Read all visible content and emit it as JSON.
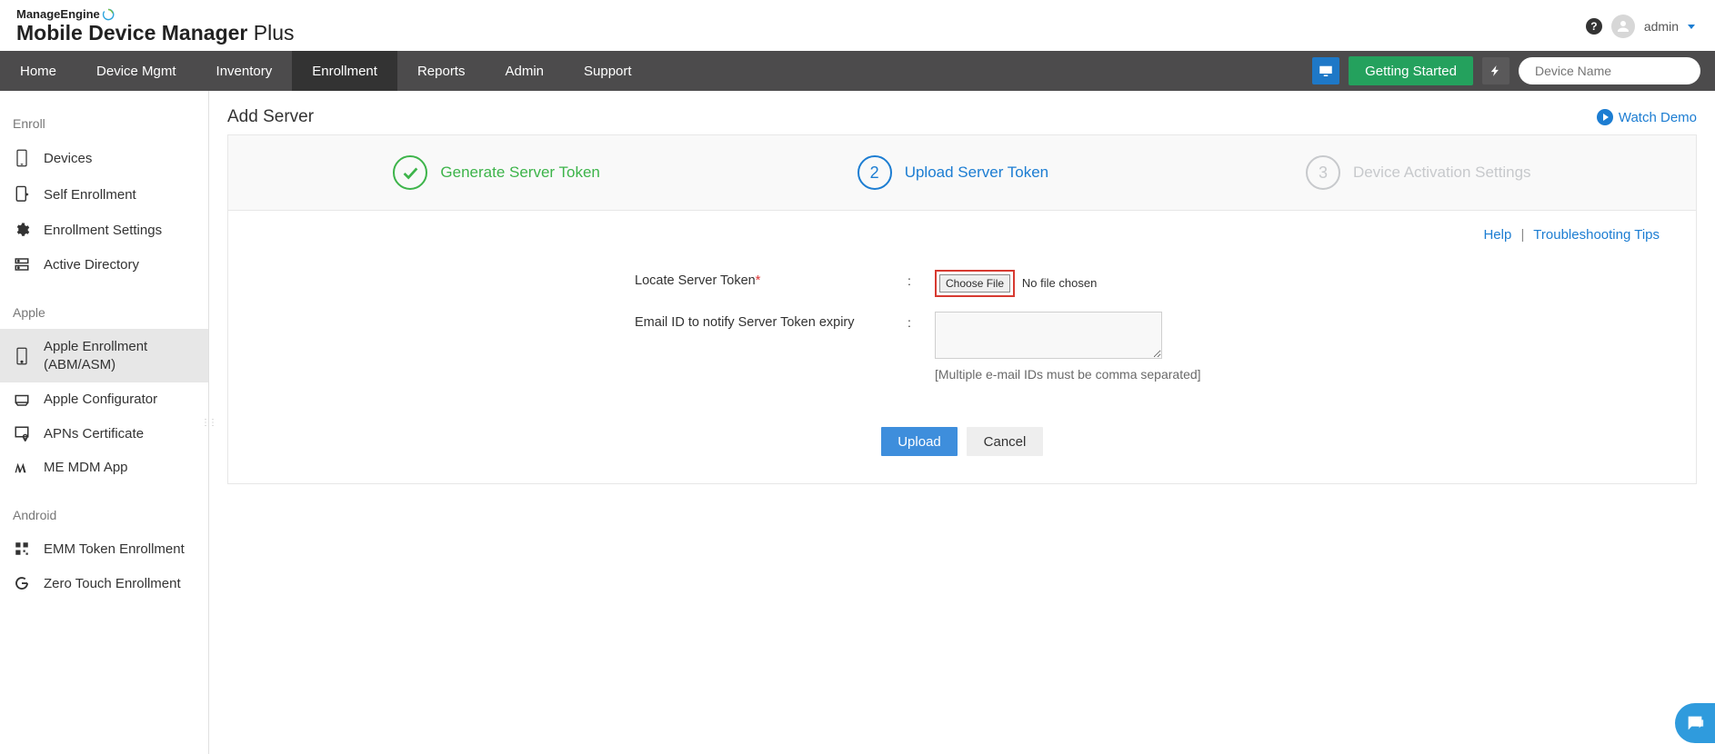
{
  "brand": {
    "top": "ManageEngine",
    "bottom_bold": "Mobile Device Manager",
    "bottom_light": " Plus"
  },
  "header": {
    "user": "admin"
  },
  "nav": {
    "items": [
      "Home",
      "Device Mgmt",
      "Inventory",
      "Enrollment",
      "Reports",
      "Admin",
      "Support"
    ],
    "active_index": 3,
    "getting_started": "Getting Started",
    "search_placeholder": "Device Name"
  },
  "sidebar": {
    "sections": [
      {
        "title": "Enroll",
        "items": [
          {
            "id": "devices",
            "label": "Devices",
            "icon": "device"
          },
          {
            "id": "self-enrollment",
            "label": "Self Enrollment",
            "icon": "self-enroll"
          },
          {
            "id": "enrollment-settings",
            "label": "Enrollment Settings",
            "icon": "gear"
          },
          {
            "id": "active-directory",
            "label": "Active Directory",
            "icon": "server"
          }
        ]
      },
      {
        "title": "Apple",
        "items": [
          {
            "id": "apple-enrollment",
            "label": "Apple Enrollment",
            "sublabel": "(ABM/ASM)",
            "icon": "apple-device",
            "active": true
          },
          {
            "id": "apple-configurator",
            "label": "Apple Configurator",
            "icon": "tray"
          },
          {
            "id": "apns-certificate",
            "label": "APNs Certificate",
            "icon": "certificate"
          },
          {
            "id": "me-mdm-app",
            "label": "ME MDM App",
            "icon": "me-app"
          }
        ]
      },
      {
        "title": "Android",
        "items": [
          {
            "id": "emm-token",
            "label": "EMM Token Enrollment",
            "icon": "qr"
          },
          {
            "id": "zero-touch",
            "label": "Zero Touch Enrollment",
            "icon": "google"
          }
        ]
      }
    ]
  },
  "page": {
    "title": "Add Server",
    "watch_demo": "Watch Demo",
    "steps": [
      {
        "label": "Generate Server Token",
        "state": "done"
      },
      {
        "label": "Upload Server Token",
        "state": "current",
        "num": "2"
      },
      {
        "label": "Device Activation Settings",
        "state": "disabled",
        "num": "3"
      }
    ],
    "help_label": "Help",
    "troubleshoot_label": "Troubleshooting Tips",
    "form": {
      "locate_label": "Locate Server Token",
      "choose_file": "Choose File",
      "no_file": "No file chosen",
      "email_label": "Email ID to notify Server Token expiry",
      "email_hint": "[Multiple e-mail IDs must be comma separated]"
    },
    "actions": {
      "upload": "Upload",
      "cancel": "Cancel"
    }
  }
}
